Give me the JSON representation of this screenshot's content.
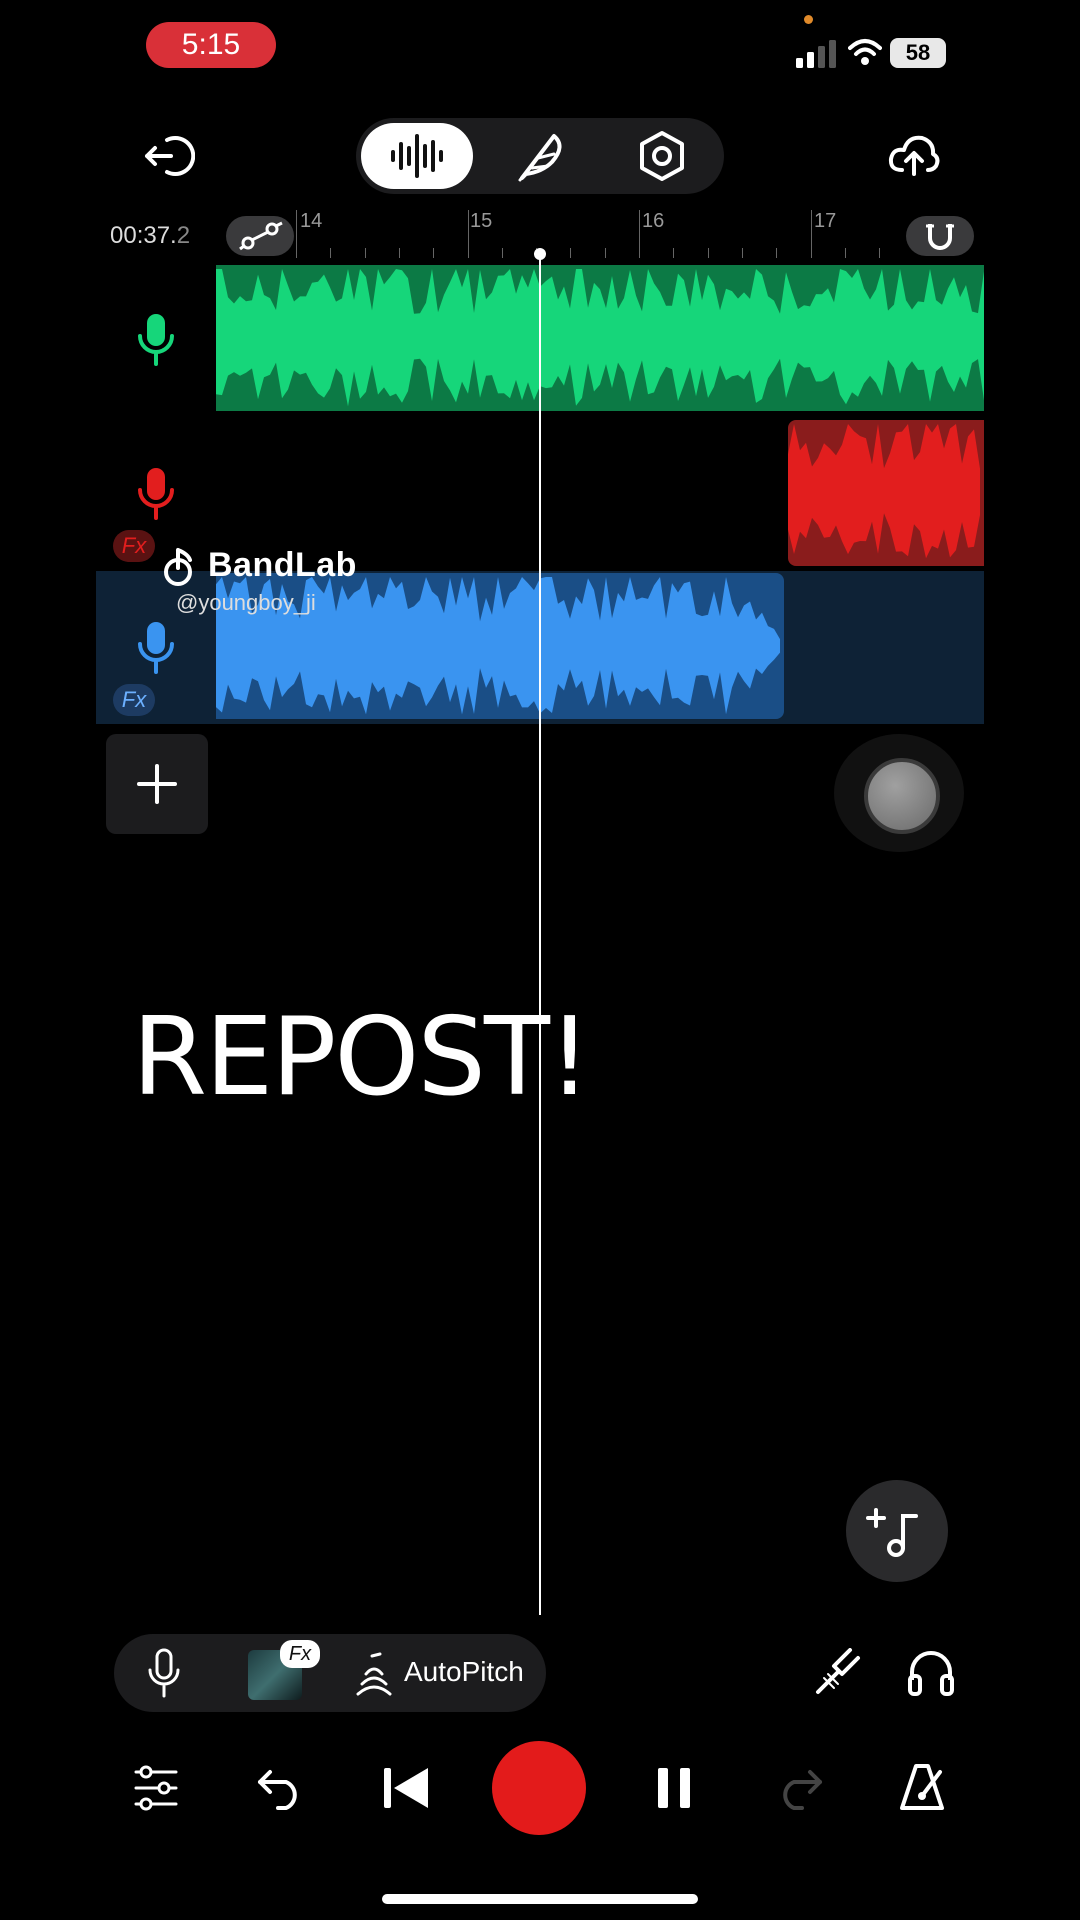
{
  "status_bar": {
    "time": "5:15",
    "battery": "58"
  },
  "top_bar": {
    "back_icon": "exit-icon",
    "modes": [
      "waveform-mode",
      "feather-mode",
      "settings-mode"
    ],
    "upload_icon": "cloud-upload-icon"
  },
  "timeline": {
    "time_main": "00:37.",
    "time_fraction": "2",
    "ruler_labels": [
      "14",
      "15",
      "16",
      "17"
    ]
  },
  "tracks": [
    {
      "color": "#16d67a",
      "fx": false
    },
    {
      "color": "#e21e1e",
      "fx": true
    },
    {
      "color": "#3a94f0",
      "fx": true
    }
  ],
  "watermark": {
    "brand": "BandLab",
    "user": "@youngboy_ji"
  },
  "overlay_text": "REPOST!",
  "tools": {
    "fx_label": "Fx",
    "autopitch_label": "AutoPitch"
  },
  "fx_badge": "Fx",
  "colors": {
    "record": "#e31b1b",
    "accent_green": "#16d67a",
    "accent_red": "#e21e1e",
    "accent_blue": "#3a94f0"
  }
}
